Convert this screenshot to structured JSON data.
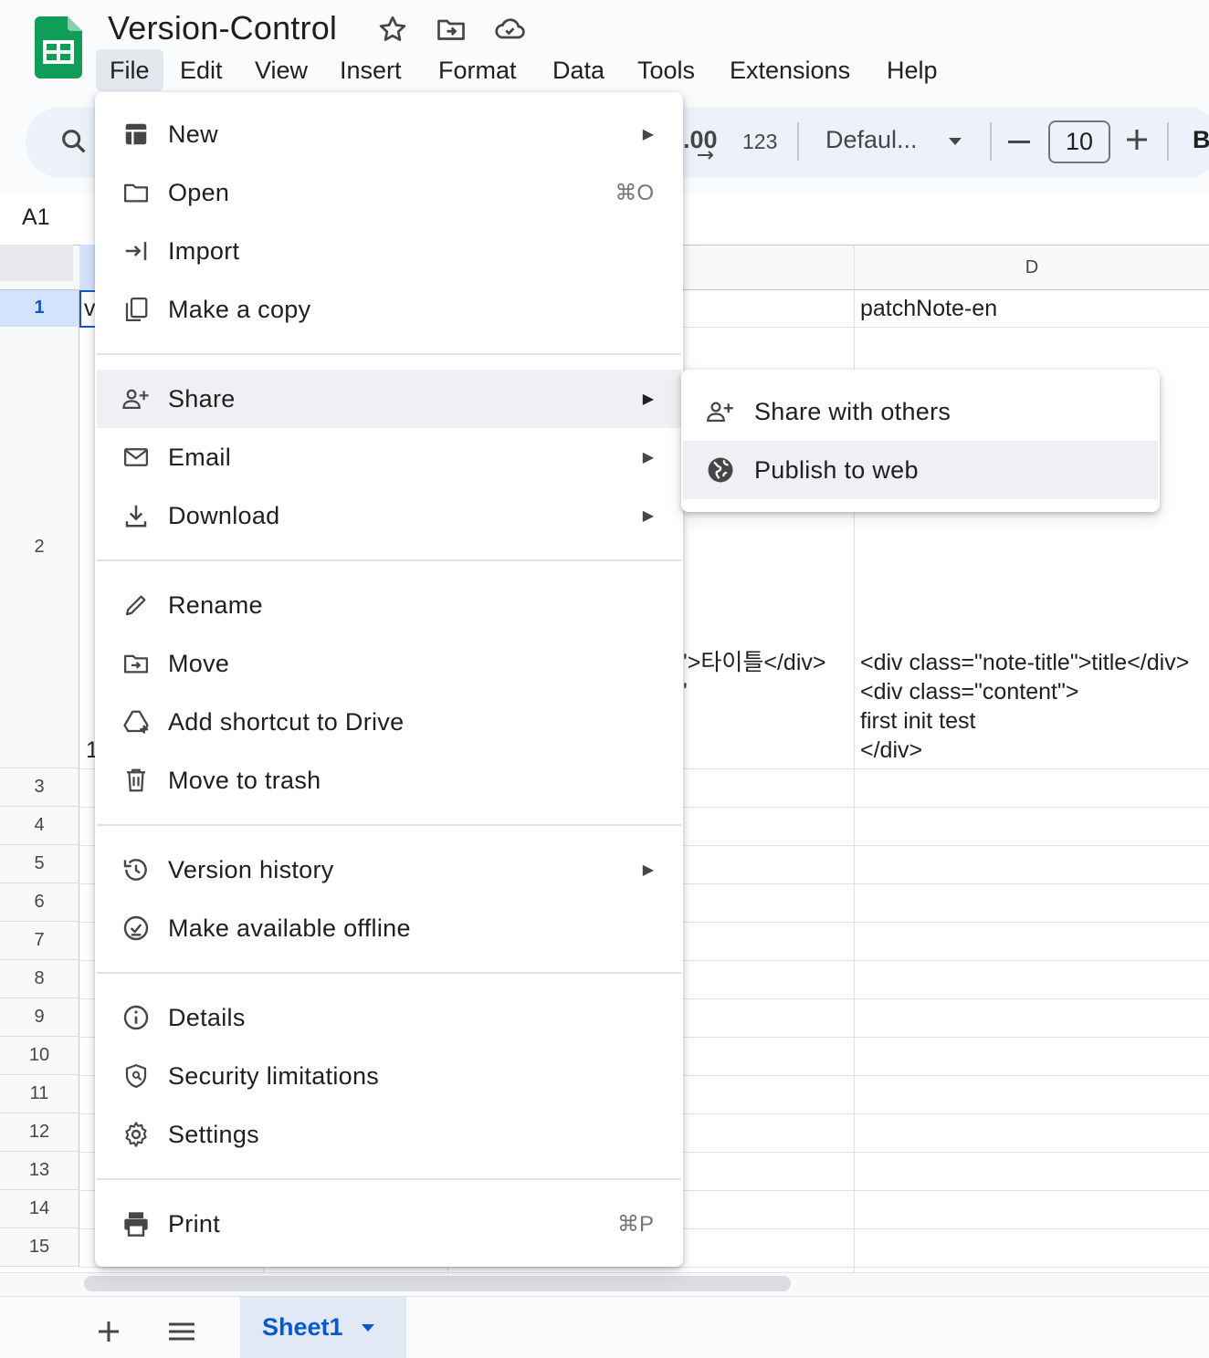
{
  "app": {
    "title": "Version-Control",
    "menu": [
      "File",
      "Edit",
      "View",
      "Insert",
      "Format",
      "Data",
      "Tools",
      "Extensions",
      "Help"
    ],
    "active_menu": "File"
  },
  "toolbar": {
    "decimal_label": ".00",
    "number_format_label": "123",
    "font_name": "Defaul...",
    "font_size": "10",
    "bold_label": "B"
  },
  "formula_bar": {
    "cell_ref": "A1"
  },
  "grid": {
    "column_d_header": "D",
    "row_numbers": [
      "1",
      "2",
      "3",
      "4",
      "5",
      "6",
      "7",
      "8",
      "9",
      "10",
      "11",
      "12",
      "13",
      "14",
      "15"
    ],
    "a1_partial": "v",
    "a2_partial": "1",
    "c2_partial": "'>타이틀</div>",
    "c2_partial_line2": "'",
    "d1": "patchNote-en",
    "d2": "<div class=\"note-title\">title</div>\n<div class=\"content\">\nfirst init test\n</div>"
  },
  "file_menu": {
    "items": [
      {
        "label": "New",
        "icon": "new-sheet-icon",
        "submenu": true
      },
      {
        "label": "Open",
        "icon": "folder-icon",
        "shortcut": "⌘O"
      },
      {
        "label": "Import",
        "icon": "import-icon"
      },
      {
        "label": "Make a copy",
        "icon": "copy-icon"
      },
      {
        "label": "Share",
        "icon": "person-add-icon",
        "submenu": true,
        "highlighted": true
      },
      {
        "label": "Email",
        "icon": "email-icon",
        "submenu": true
      },
      {
        "label": "Download",
        "icon": "download-icon",
        "submenu": true
      },
      {
        "label": "Rename",
        "icon": "pencil-icon"
      },
      {
        "label": "Move",
        "icon": "move-folder-icon"
      },
      {
        "label": "Add shortcut to Drive",
        "icon": "drive-shortcut-icon"
      },
      {
        "label": "Move to trash",
        "icon": "trash-icon"
      },
      {
        "label": "Version history",
        "icon": "history-icon",
        "submenu": true
      },
      {
        "label": "Make available offline",
        "icon": "offline-icon"
      },
      {
        "label": "Details",
        "icon": "info-icon"
      },
      {
        "label": "Security limitations",
        "icon": "shield-icon"
      },
      {
        "label": "Settings",
        "icon": "gear-icon"
      },
      {
        "label": "Print",
        "icon": "print-icon",
        "shortcut": "⌘P"
      }
    ]
  },
  "share_submenu": {
    "items": [
      {
        "label": "Share with others",
        "icon": "person-add-icon"
      },
      {
        "label": "Publish to web",
        "icon": "globe-icon",
        "highlighted": true
      }
    ]
  },
  "sheets": {
    "active_sheet": "Sheet1"
  },
  "colors": {
    "accent": "#0b57d0",
    "sheets_green": "#0f9d58",
    "menu_highlight": "#eef0f3"
  }
}
